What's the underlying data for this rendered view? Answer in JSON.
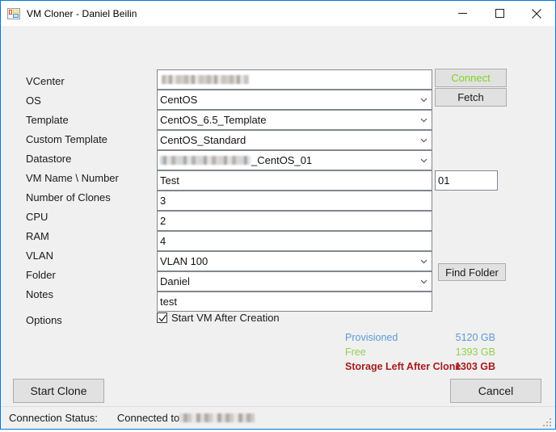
{
  "window": {
    "title": "VM Cloner - Daniel Beilin",
    "icon": "vs-form-icon",
    "controls": {
      "minimize": "minimize-icon",
      "maximize": "maximize-icon",
      "close": "close-icon"
    },
    "border_color": "#0078d7"
  },
  "form": {
    "rows": [
      {
        "label": "VCenter",
        "type": "text",
        "value": "",
        "redacted": true
      },
      {
        "label": "OS",
        "type": "combo",
        "value": "CentOS"
      },
      {
        "label": "Template",
        "type": "combo",
        "value": "CentOS_6.5_Template"
      },
      {
        "label": "Custom Template",
        "type": "combo",
        "value": "CentOS_Standard"
      },
      {
        "label": "Datastore",
        "type": "combo",
        "value": "_CentOS_01",
        "redacted_prefix": true
      },
      {
        "label": "VM Name \\ Number",
        "type": "text",
        "value": "Test"
      },
      {
        "label": "Number of Clones",
        "type": "text",
        "value": "3"
      },
      {
        "label": "CPU",
        "type": "text",
        "value": "2"
      },
      {
        "label": "RAM",
        "type": "text",
        "value": "4"
      },
      {
        "label": "VLAN",
        "type": "combo",
        "value": "VLAN 100"
      },
      {
        "label": "Folder",
        "type": "combo",
        "value": "Daniel"
      },
      {
        "label": "Notes",
        "type": "text",
        "value": "test"
      }
    ],
    "vm_number_value": "01"
  },
  "buttons": {
    "connect": {
      "label": "Connect",
      "color": "#7ed321"
    },
    "fetch": {
      "label": "Fetch"
    },
    "find_folder": {
      "label": "Find Folder"
    },
    "start_clone": {
      "label": "Start Clone"
    },
    "cancel": {
      "label": "Cancel"
    }
  },
  "options": {
    "label": "Options",
    "checkbox_label": "Start VM After Creation",
    "checked": true
  },
  "storage": {
    "rows": [
      {
        "label": "Provisioned",
        "value": "5120 GB",
        "color": "#5b9bd5"
      },
      {
        "label": "Free",
        "value": "1393 GB",
        "color": "#92d050"
      },
      {
        "label": "Storage Left After Clone",
        "value": "1303 GB",
        "color": "#a61b1b",
        "bold": true
      }
    ]
  },
  "statusbar": {
    "label": "Connection Status:",
    "value_prefix": "Connected to ",
    "value_redacted": true,
    "grip": "resize-grip-icon"
  }
}
